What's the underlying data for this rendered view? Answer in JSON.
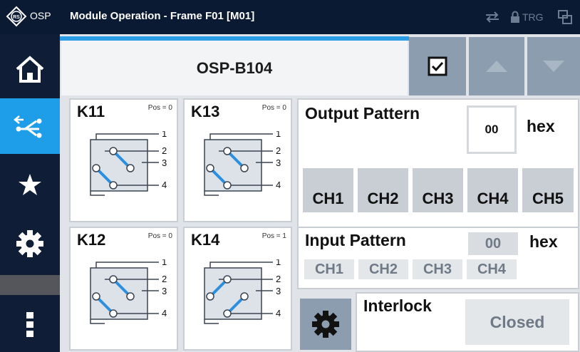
{
  "titlebar": {
    "app_label": "OSP",
    "title": "Module Operation - Frame F01 [M01]",
    "trg_label": "TRG",
    "icons": [
      "rs-logo-icon",
      "transfer-arrows-icon",
      "lock-icon",
      "screen-copy-icon"
    ]
  },
  "sidebar": {
    "items": [
      {
        "name": "home",
        "icon": "home-icon",
        "active": false
      },
      {
        "name": "switch",
        "icon": "switch-path-icon",
        "active": true
      },
      {
        "name": "favorites",
        "icon": "star-icon",
        "active": false
      },
      {
        "name": "settings",
        "icon": "gear-icon",
        "active": false
      },
      {
        "name": "more",
        "icon": "more-vertical-icon",
        "active": false
      }
    ]
  },
  "header": {
    "module_name": "OSP-B104",
    "buttons": [
      "checkbox-checked-icon",
      "arrow-up-icon",
      "arrow-down-icon"
    ]
  },
  "relays": [
    {
      "name": "K11",
      "pos": "Pos = 0",
      "ports": [
        "1",
        "2",
        "3",
        "4"
      ]
    },
    {
      "name": "K13",
      "pos": "Pos = 0",
      "ports": [
        "1",
        "2",
        "3",
        "4"
      ]
    },
    {
      "name": "K12",
      "pos": "Pos = 0",
      "ports": [
        "1",
        "2",
        "3",
        "4"
      ]
    },
    {
      "name": "K14",
      "pos": "Pos = 1",
      "ports": [
        "1",
        "2",
        "3",
        "4"
      ]
    }
  ],
  "output_pattern": {
    "title": "Output Pattern",
    "value": "00",
    "unit": "hex",
    "channels": [
      "CH1",
      "CH2",
      "CH3",
      "CH4",
      "CH5"
    ]
  },
  "input_pattern": {
    "title": "Input Pattern",
    "value": "00",
    "unit": "hex",
    "channels": [
      "CH1",
      "CH2",
      "CH3",
      "CH4"
    ]
  },
  "interlock": {
    "title": "Interlock",
    "state": "Closed"
  },
  "colors": {
    "titlebar_bg": "#0b1a33",
    "sidebar_bg": "#101d37",
    "accent_blue": "#1e9de8",
    "button_gray": "#8d9db0",
    "panel_bg": "#e0e3e7"
  }
}
